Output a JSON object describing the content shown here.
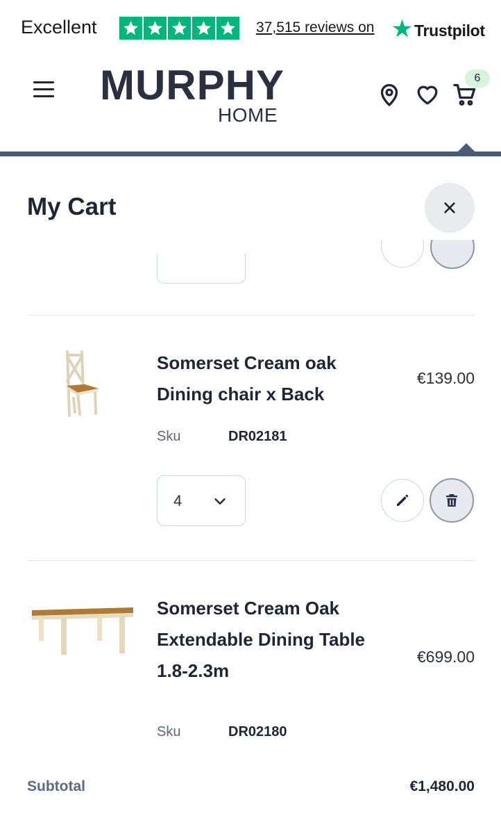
{
  "trustpilot": {
    "rating_label": "Excellent",
    "reviews": "37,515 reviews on",
    "brand": "Trustpilot",
    "star_color": "#00b67a"
  },
  "header": {
    "logo_main": "MURPHY",
    "logo_sub": "HOME",
    "cart_count": "6",
    "icons": [
      "menu-icon",
      "location-pin-icon",
      "heart-icon",
      "cart-icon"
    ]
  },
  "cart": {
    "title": "My Cart",
    "items": [
      {
        "name": "Somerset Cream oak Dining chair x Back",
        "price": "€139.00",
        "sku_label": "Sku",
        "sku": "DR02181",
        "qty": "4"
      },
      {
        "name": "Somerset Cream Oak Extendable Dining Table 1.8-2.3m",
        "price": "€699.00",
        "sku_label": "Sku",
        "sku": "DR02180"
      }
    ],
    "subtotal_label": "Subtotal",
    "subtotal_value": "€1,480.00"
  }
}
